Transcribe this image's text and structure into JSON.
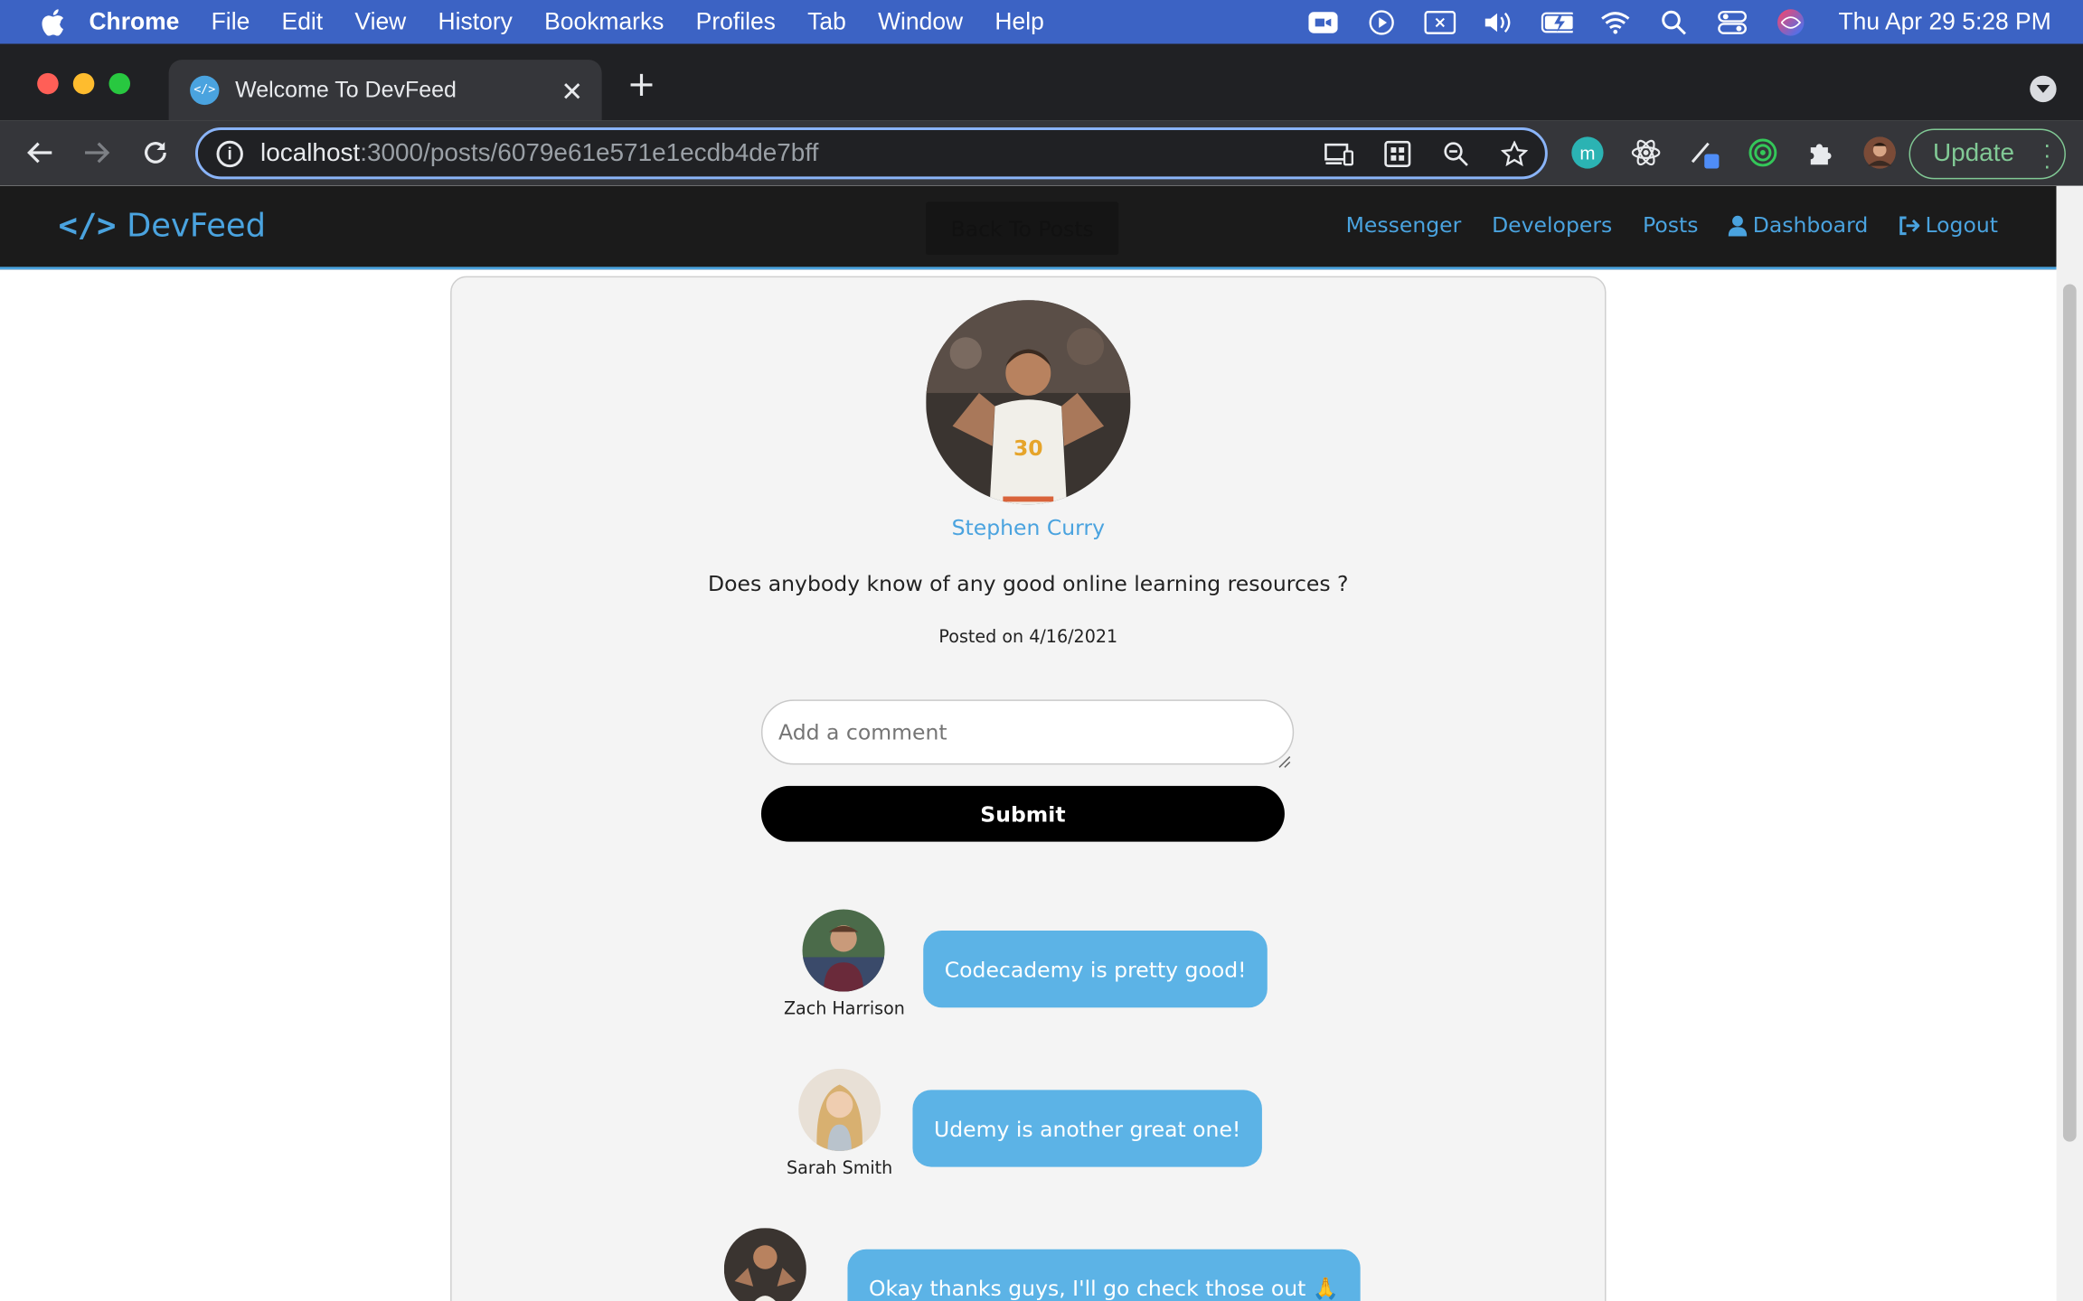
{
  "menubar": {
    "app": "Chrome",
    "items": [
      "File",
      "Edit",
      "View",
      "History",
      "Bookmarks",
      "Profiles",
      "Tab",
      "Window",
      "Help"
    ],
    "clock": "Thu Apr 29  5:28 PM"
  },
  "browser": {
    "tab_title": "Welcome To DevFeed",
    "url_host": "localhost",
    "url_path": ":3000/posts/6079e61e571e1ecdb4de7bff",
    "update_label": "Update"
  },
  "navbar": {
    "brand": "DevFeed",
    "back_label": "Back To Posts",
    "links": {
      "messenger": "Messenger",
      "developers": "Developers",
      "posts": "Posts",
      "dashboard": "Dashboard",
      "logout": "Logout"
    }
  },
  "post": {
    "author": "Stephen Curry",
    "text": "Does anybody know of any good online learning resources ?",
    "date": "Posted on 4/16/2021"
  },
  "comment_form": {
    "placeholder": "Add a comment",
    "submit_label": "Submit"
  },
  "comments": [
    {
      "author": "Zach Harrison",
      "text": "Codecademy is pretty good!"
    },
    {
      "author": "Sarah Smith",
      "text": "Udemy is another great one!"
    },
    {
      "author": "",
      "text": "Okay thanks guys, I'll go check those out 🙏"
    }
  ],
  "colors": {
    "accent": "#4aa3df",
    "bubble": "#5cb3e6",
    "menubar": "#3c63c4"
  }
}
